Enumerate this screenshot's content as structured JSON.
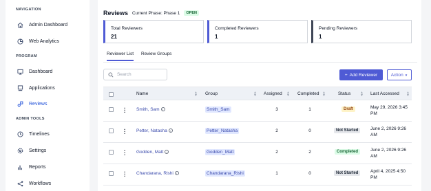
{
  "sidebar": {
    "sections": [
      {
        "label": "NAVIGATION"
      },
      {
        "label": "PROGRAM"
      },
      {
        "label": "ADMIN TOOLS"
      }
    ],
    "items": [
      {
        "label": "Admin Dashboard",
        "icon": "home-icon"
      },
      {
        "label": "Web Analytics",
        "icon": "analytics-icon"
      },
      {
        "label": "Dashboard",
        "icon": "monitor-icon"
      },
      {
        "label": "Applications",
        "icon": "applications-icon"
      },
      {
        "label": "Reviews",
        "icon": "reviews-icon",
        "active": true
      },
      {
        "label": "Timelines",
        "icon": "clock-icon"
      },
      {
        "label": "Settings",
        "icon": "gear-icon"
      },
      {
        "label": "Reports",
        "icon": "bar-chart-icon"
      },
      {
        "label": "Workflows",
        "icon": "workflow-icon"
      }
    ]
  },
  "header": {
    "title": "Reviews",
    "phase_label": "Current Phase: Phase 1",
    "phase_badge": "OPEN"
  },
  "stats": [
    {
      "label": "Total Reviewers",
      "value": "21"
    },
    {
      "label": "Completed Reviewers",
      "value": "1"
    },
    {
      "label": "Pending Reviewers",
      "value": "1"
    }
  ],
  "tabs": [
    {
      "label": "Reviewer List",
      "active": true
    },
    {
      "label": "Review Groups",
      "active": false
    }
  ],
  "search": {
    "placeholder": "Search",
    "value": ""
  },
  "buttons": {
    "add_reviewer": "Add Reviewer",
    "action": "Action"
  },
  "colors": {
    "accent": "#4f5bd5",
    "draft": "#fef3c7",
    "completed": "#dcfce7",
    "not_started": "#e5e7eb"
  },
  "table": {
    "columns": [
      "Name",
      "Group",
      "Assigned",
      "Completed",
      "Status",
      "Last Accessed"
    ],
    "rows": [
      {
        "name": "Smith, Sam",
        "group": "Smith_Sam",
        "assigned": "3",
        "completed": "1",
        "status": "Draft",
        "last_accessed": "May 29, 2026 3:45 PM"
      },
      {
        "name": "Petter, Natasha",
        "group": "Petter_Natasha",
        "assigned": "2",
        "completed": "0",
        "status": "Not Started",
        "last_accessed": "June 2, 2026 9:26 AM"
      },
      {
        "name": "Godden, Matt",
        "group": "Godden_Matt",
        "assigned": "2",
        "completed": "2",
        "status": "Completed",
        "last_accessed": "June 2, 2026 9:26 AM"
      },
      {
        "name": "Chandarana, Rishi",
        "group": "Chandarana_Rishi",
        "assigned": "1",
        "completed": "0",
        "status": "Not Started",
        "last_accessed": "April 4, 2025 4:50 PM"
      }
    ]
  }
}
